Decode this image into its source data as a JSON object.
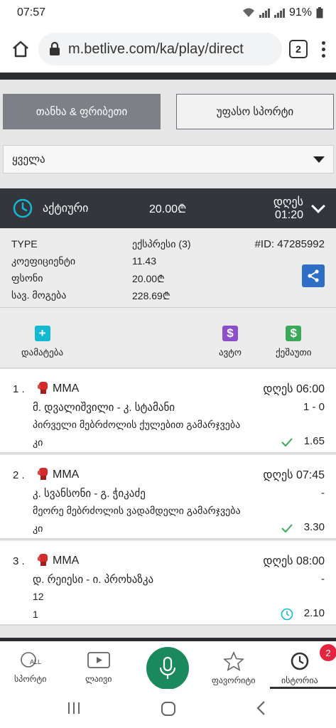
{
  "status_bar": {
    "time": "07:57",
    "battery": "91%"
  },
  "browser": {
    "url": "m.betlive.com/ka/play/direct",
    "tab_count": "2"
  },
  "toggles": {
    "left": "თანხა & ფრიბეთი",
    "right": "უფასო სპორტი"
  },
  "filter": {
    "value": "ყველა"
  },
  "bet": {
    "status": "აქტიური",
    "amount": "20.00₾",
    "date": "დღეს 01:20",
    "type_label": "TYPE",
    "type_value": "ექსპრესი (3)",
    "id": "#ID: 47285992",
    "coef_label": "კოეფიციენტი",
    "coef_value": "11.43",
    "stake_label": "ფსონი",
    "stake_value": "20.00₾",
    "win_label": "სავ. მოგება",
    "win_value": "228.69₾"
  },
  "actions": {
    "add": "დამატება",
    "auto": "ავტო",
    "cashout": "ქეშაუთი"
  },
  "selections": [
    {
      "num": "1 .",
      "sport": "MMA",
      "time": "დღეს 06:00",
      "teams": "მ. დვალიშვილი - კ. სტამანი",
      "score": "1 - 0",
      "market": "პირველი მებრძოლის ქულებით გამარჯვება",
      "pick": "კი",
      "odd": "1.65",
      "status_icon": "check-icon"
    },
    {
      "num": "2 .",
      "sport": "MMA",
      "time": "დღეს 07:45",
      "teams": "კ. სვანსონი - გ. ჭიკაძე",
      "score": "-",
      "market": "მეორე მებრძოლის ვადამდელი გამარჯვება",
      "pick": "კი",
      "odd": "3.30",
      "status_icon": "check-icon"
    },
    {
      "num": "3 .",
      "sport": "MMA",
      "time": "დღეს 08:00",
      "teams": "დ. რეიესი - ი. პროხაზკა",
      "score": "-",
      "market": "12",
      "pick": "1",
      "odd": "2.10",
      "status_icon": "clock-icon"
    }
  ],
  "bottom_nav": {
    "sports": "სპორტი",
    "sports_icon_text": "ALL",
    "live": "ლაივი",
    "favorites": "ფავორიტი",
    "history": "ისტორია",
    "history_badge": "2"
  },
  "colors": {
    "accent_cyan": "#14b8d0",
    "auto_purple": "#8a4fc9",
    "cashout_green": "#3aa95a",
    "share_blue": "#2e6ec7",
    "mic_green": "#1a8a5c"
  }
}
